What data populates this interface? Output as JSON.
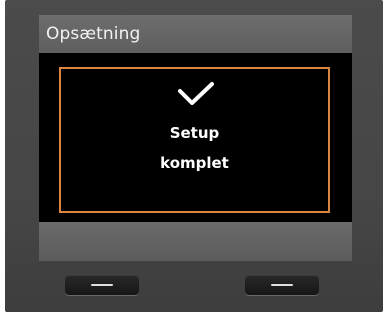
{
  "header": {
    "title": "Opsætning"
  },
  "message": {
    "icon": "checkmark-icon",
    "line1": "Setup",
    "line2": "komplet"
  },
  "colors": {
    "accent_border": "#d9843f",
    "header_bg": "#656565",
    "content_bg": "#000000",
    "text": "#ffffff"
  },
  "hardware_keys": [
    {
      "name": "left-softkey",
      "icon": "dash-icon"
    },
    {
      "name": "right-softkey",
      "icon": "dash-icon"
    }
  ]
}
